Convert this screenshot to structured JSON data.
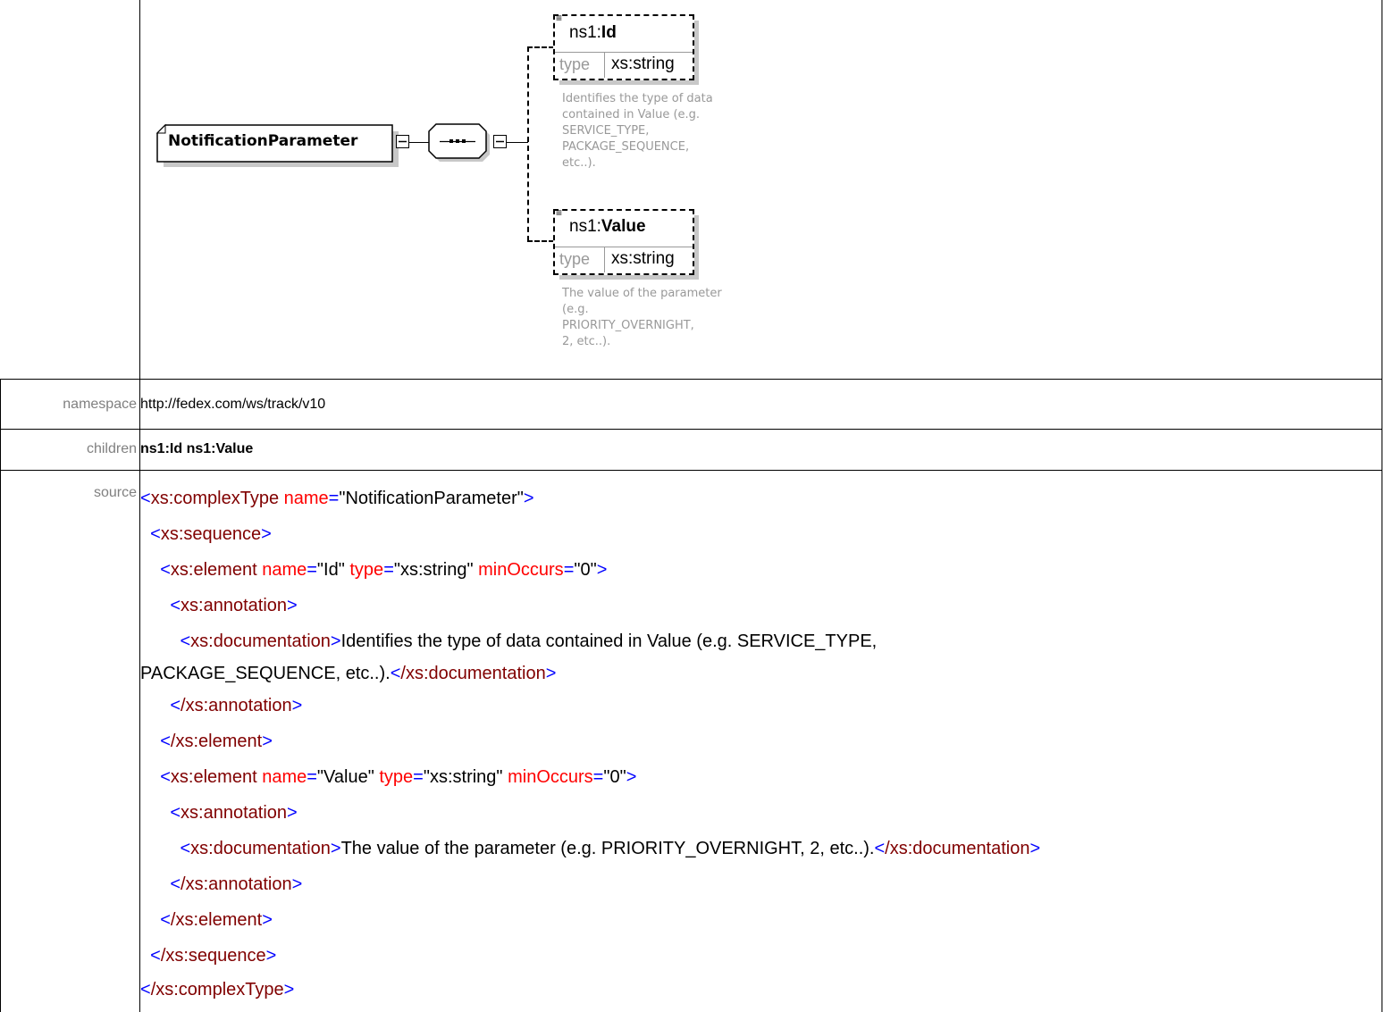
{
  "diagram": {
    "complex_type_name": "NotificationParameter",
    "elements": [
      {
        "prefix": "ns1:",
        "name": "Id",
        "type_label": "type",
        "type_value": "xs:string",
        "doc": [
          "Identifies the type of data",
          "contained in Value (e.g.",
          "SERVICE_TYPE,",
          "PACKAGE_SEQUENCE,",
          "etc..)."
        ]
      },
      {
        "prefix": "ns1:",
        "name": "Value",
        "type_label": "type",
        "type_value": "xs:string",
        "doc": [
          "The value of the parameter",
          "(e.g.",
          "PRIORITY_OVERNIGHT,",
          "2, etc..)."
        ]
      }
    ]
  },
  "rows": {
    "namespace": {
      "label": "namespace",
      "value": "http://fedex.com/ws/track/v10"
    },
    "children": {
      "label": "children",
      "value": "ns1:Id ns1:Value"
    },
    "source": {
      "label": "source"
    }
  },
  "source": {
    "l1_tag": "xs:complexType",
    "l1_attr": "name",
    "l1_val": "\"NotificationParameter\"",
    "l2_tag": "xs:sequence",
    "l3_tag": "xs:element",
    "l3_a1": "name",
    "l3_v1": "\"Id\"",
    "l3_a2": "type",
    "l3_v2": "\"xs:string\"",
    "l3_a3": "minOccurs",
    "l3_v3": "\"0\"",
    "ann_tag": "xs:annotation",
    "doc_tag": "xs:documentation",
    "doc1_text_a": "Identifies the type of data contained in Value (e.g. SERVICE_TYPE,",
    "doc1_text_b": "PACKAGE_SEQUENCE, etc..).",
    "close_ann": "/xs:annotation",
    "close_el": "/xs:element",
    "l8_v1": "\"Value\"",
    "doc2_text": "The value of the parameter (e.g. PRIORITY_OVERNIGHT, 2, etc..).",
    "close_doc": "/xs:documentation",
    "close_seq": "/xs:sequence",
    "close_ct": "/xs:complexType"
  }
}
